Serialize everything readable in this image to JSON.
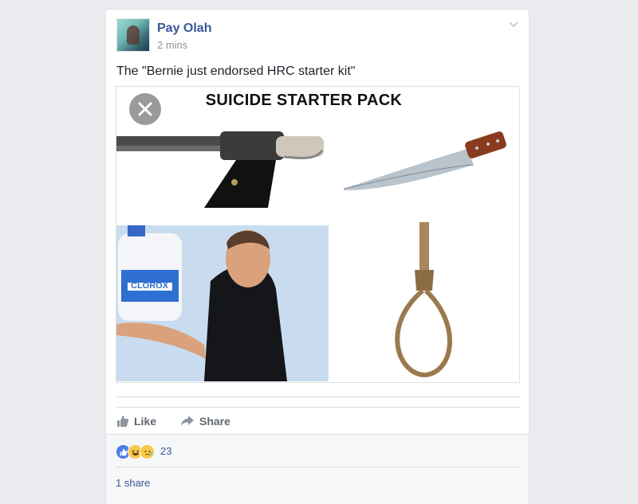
{
  "post": {
    "author": "Pay Olah",
    "timestamp": "2 mins",
    "text": "The \"Bernie just endorsed HRC starter kit\"",
    "image": {
      "title": "SUICIDE STARTER PACK",
      "bleach_label": "CLOROX"
    }
  },
  "actions": {
    "like_label": "Like",
    "share_label": "Share"
  },
  "reactions": {
    "icons": [
      "like-icon",
      "haha-icon",
      "sad-icon"
    ],
    "count": "23"
  },
  "shares": {
    "label": "1 share"
  },
  "colors": {
    "link": "#385898",
    "background": "#e9ebee",
    "like_blue": "#4a7ee8"
  }
}
